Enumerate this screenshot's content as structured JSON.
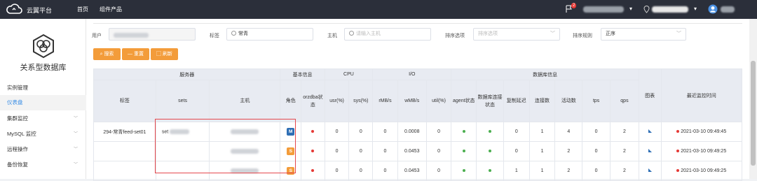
{
  "topbar": {
    "brand": "云翼平台",
    "nav": [
      "首页",
      "组件产品"
    ],
    "notify_count": "2"
  },
  "sidebar": {
    "title": "关系型数据库",
    "items": [
      {
        "label": "实例管理",
        "expandable": false,
        "active": false
      },
      {
        "label": "仪表盘",
        "expandable": false,
        "active": true
      },
      {
        "label": "集群监控",
        "expandable": true,
        "active": false
      },
      {
        "label": "MySQL 监控",
        "expandable": true,
        "active": false
      },
      {
        "label": "远程操作",
        "expandable": true,
        "active": false
      },
      {
        "label": "备份恢复",
        "expandable": true,
        "active": false
      }
    ]
  },
  "filters": {
    "user_label": "用户",
    "tag_label": "标签",
    "tag_value": "常青",
    "host_label": "主机",
    "host_placeholder": "请输入主机",
    "sort_option_label": "排序选项",
    "sort_option_placeholder": "排序选项",
    "sort_rule_label": "排序规则",
    "sort_rule_value": "正序"
  },
  "buttons": {
    "search": "搜索",
    "reset": "重置",
    "refresh": "刷新"
  },
  "table": {
    "groups": {
      "server": "服务器",
      "basic": "基本信息",
      "cpu": "CPU",
      "io": "I/O",
      "db": "数据库信息",
      "chart": "图表",
      "last_time": "最近监控时间"
    },
    "columns": {
      "tag": "标签",
      "sets": "sets",
      "host": "主机",
      "role": "角色",
      "orzdba": "orzdba状态",
      "usr": "usr(%)",
      "sys": "sys(%)",
      "rmb": "rMB/s",
      "wmb": "wMB/s",
      "util": "util(%)",
      "agent": "agent状态",
      "dbconn": "数据库连接状态",
      "repl": "复制延迟",
      "conns": "连接数",
      "active": "活动数",
      "tps": "tps",
      "qps": "qps"
    },
    "rows": [
      {
        "tag": "294-常青feed-set01",
        "sets": "set",
        "role": "M",
        "usr": "0",
        "sys": "0",
        "rmb": "0",
        "wmb": "0.0008",
        "util": "0",
        "repl": "0",
        "conns": "1",
        "active": "4",
        "tps": "0",
        "qps": "2",
        "time": "2021-03-10 09:49:45"
      },
      {
        "tag": "",
        "sets": "",
        "role": "S",
        "usr": "0",
        "sys": "0",
        "rmb": "0",
        "wmb": "0.0453",
        "util": "0",
        "repl": "0",
        "conns": "1",
        "active": "2",
        "tps": "0",
        "qps": "2",
        "time": "2021-03-10 09:49:25"
      },
      {
        "tag": "",
        "sets": "",
        "role": "S",
        "usr": "0",
        "sys": "0",
        "rmb": "0",
        "wmb": "0.0453",
        "util": "0",
        "repl": "1",
        "conns": "1",
        "active": "2",
        "tps": "0",
        "qps": "2",
        "time": "2021-03-10 09:49:25"
      }
    ]
  },
  "colors": {
    "topbar_bg": "#2b2f3a",
    "accent_orange": "#f39c3a",
    "active_blue": "#3a8ee6",
    "status_red": "#e53935",
    "status_green": "#4caf50",
    "highlight_box": "#e5484d"
  }
}
